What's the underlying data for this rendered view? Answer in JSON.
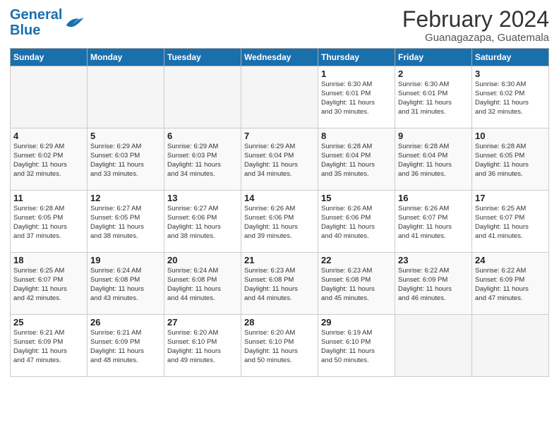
{
  "logo": {
    "line1": "General",
    "line2": "Blue"
  },
  "title": "February 2024",
  "subtitle": "Guanagazapa, Guatemala",
  "headers": [
    "Sunday",
    "Monday",
    "Tuesday",
    "Wednesday",
    "Thursday",
    "Friday",
    "Saturday"
  ],
  "weeks": [
    [
      {
        "day": "",
        "info": ""
      },
      {
        "day": "",
        "info": ""
      },
      {
        "day": "",
        "info": ""
      },
      {
        "day": "",
        "info": ""
      },
      {
        "day": "1",
        "info": "Sunrise: 6:30 AM\nSunset: 6:01 PM\nDaylight: 11 hours\nand 30 minutes."
      },
      {
        "day": "2",
        "info": "Sunrise: 6:30 AM\nSunset: 6:01 PM\nDaylight: 11 hours\nand 31 minutes."
      },
      {
        "day": "3",
        "info": "Sunrise: 6:30 AM\nSunset: 6:02 PM\nDaylight: 11 hours\nand 32 minutes."
      }
    ],
    [
      {
        "day": "4",
        "info": "Sunrise: 6:29 AM\nSunset: 6:02 PM\nDaylight: 11 hours\nand 32 minutes."
      },
      {
        "day": "5",
        "info": "Sunrise: 6:29 AM\nSunset: 6:03 PM\nDaylight: 11 hours\nand 33 minutes."
      },
      {
        "day": "6",
        "info": "Sunrise: 6:29 AM\nSunset: 6:03 PM\nDaylight: 11 hours\nand 34 minutes."
      },
      {
        "day": "7",
        "info": "Sunrise: 6:29 AM\nSunset: 6:04 PM\nDaylight: 11 hours\nand 34 minutes."
      },
      {
        "day": "8",
        "info": "Sunrise: 6:28 AM\nSunset: 6:04 PM\nDaylight: 11 hours\nand 35 minutes."
      },
      {
        "day": "9",
        "info": "Sunrise: 6:28 AM\nSunset: 6:04 PM\nDaylight: 11 hours\nand 36 minutes."
      },
      {
        "day": "10",
        "info": "Sunrise: 6:28 AM\nSunset: 6:05 PM\nDaylight: 11 hours\nand 36 minutes."
      }
    ],
    [
      {
        "day": "11",
        "info": "Sunrise: 6:28 AM\nSunset: 6:05 PM\nDaylight: 11 hours\nand 37 minutes."
      },
      {
        "day": "12",
        "info": "Sunrise: 6:27 AM\nSunset: 6:05 PM\nDaylight: 11 hours\nand 38 minutes."
      },
      {
        "day": "13",
        "info": "Sunrise: 6:27 AM\nSunset: 6:06 PM\nDaylight: 11 hours\nand 38 minutes."
      },
      {
        "day": "14",
        "info": "Sunrise: 6:26 AM\nSunset: 6:06 PM\nDaylight: 11 hours\nand 39 minutes."
      },
      {
        "day": "15",
        "info": "Sunrise: 6:26 AM\nSunset: 6:06 PM\nDaylight: 11 hours\nand 40 minutes."
      },
      {
        "day": "16",
        "info": "Sunrise: 6:26 AM\nSunset: 6:07 PM\nDaylight: 11 hours\nand 41 minutes."
      },
      {
        "day": "17",
        "info": "Sunrise: 6:25 AM\nSunset: 6:07 PM\nDaylight: 11 hours\nand 41 minutes."
      }
    ],
    [
      {
        "day": "18",
        "info": "Sunrise: 6:25 AM\nSunset: 6:07 PM\nDaylight: 11 hours\nand 42 minutes."
      },
      {
        "day": "19",
        "info": "Sunrise: 6:24 AM\nSunset: 6:08 PM\nDaylight: 11 hours\nand 43 minutes."
      },
      {
        "day": "20",
        "info": "Sunrise: 6:24 AM\nSunset: 6:08 PM\nDaylight: 11 hours\nand 44 minutes."
      },
      {
        "day": "21",
        "info": "Sunrise: 6:23 AM\nSunset: 6:08 PM\nDaylight: 11 hours\nand 44 minutes."
      },
      {
        "day": "22",
        "info": "Sunrise: 6:23 AM\nSunset: 6:08 PM\nDaylight: 11 hours\nand 45 minutes."
      },
      {
        "day": "23",
        "info": "Sunrise: 6:22 AM\nSunset: 6:09 PM\nDaylight: 11 hours\nand 46 minutes."
      },
      {
        "day": "24",
        "info": "Sunrise: 6:22 AM\nSunset: 6:09 PM\nDaylight: 11 hours\nand 47 minutes."
      }
    ],
    [
      {
        "day": "25",
        "info": "Sunrise: 6:21 AM\nSunset: 6:09 PM\nDaylight: 11 hours\nand 47 minutes."
      },
      {
        "day": "26",
        "info": "Sunrise: 6:21 AM\nSunset: 6:09 PM\nDaylight: 11 hours\nand 48 minutes."
      },
      {
        "day": "27",
        "info": "Sunrise: 6:20 AM\nSunset: 6:10 PM\nDaylight: 11 hours\nand 49 minutes."
      },
      {
        "day": "28",
        "info": "Sunrise: 6:20 AM\nSunset: 6:10 PM\nDaylight: 11 hours\nand 50 minutes."
      },
      {
        "day": "29",
        "info": "Sunrise: 6:19 AM\nSunset: 6:10 PM\nDaylight: 11 hours\nand 50 minutes."
      },
      {
        "day": "",
        "info": ""
      },
      {
        "day": "",
        "info": ""
      }
    ]
  ]
}
